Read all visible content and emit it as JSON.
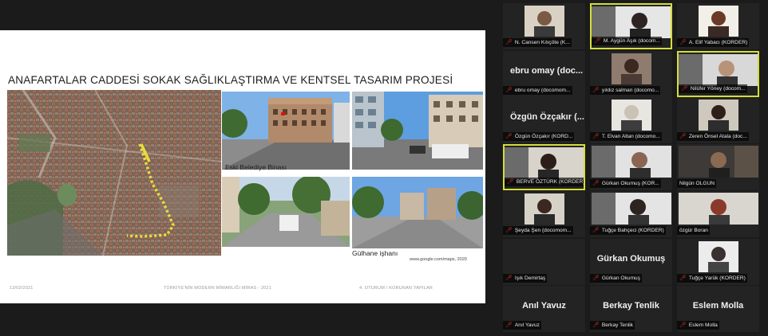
{
  "slide": {
    "title": "ANAFARTALAR CADDESİ SOKAK SAĞLIKLAŞTIRMA VE KENTSEL TASARIM PROJESİ",
    "captions": {
      "photo1": "Eski Belediye Binası",
      "photo2": "Gülhane işhanı",
      "source": "www.google.com/maps, 2020"
    },
    "footer": {
      "date": "13/02/2021",
      "course": "TÜRKİYE'NİN MODERN MİMARLIĞI MİRAS - 2021",
      "section": "4. OTURUM / KORUNAN YAPILAR"
    }
  },
  "participants": [
    {
      "name": "N. Cansen Kılıçöte (K...",
      "big": "",
      "active": false
    },
    {
      "name": "M. Aygün Aşık (docom...",
      "big": "",
      "active": true
    },
    {
      "name": "A. Elif Yabacı (KORDER)",
      "big": "",
      "active": false
    },
    {
      "name": "ebru omay (docomom...",
      "big": "ebru omay (doc...",
      "active": false
    },
    {
      "name": "yıldız salman (docomo...",
      "big": "",
      "active": false
    },
    {
      "name": "Nilüfer Yöney (docom...",
      "big": "",
      "active": true
    },
    {
      "name": "Özgün Özçakır (KORD...",
      "big": "Özgün Özçakır (...",
      "active": false
    },
    {
      "name": "T. Elvan Altan (docomo...",
      "big": "",
      "active": false
    },
    {
      "name": "Zeren Önsel Atala (doc...",
      "big": "",
      "active": false
    },
    {
      "name": "BERVE ÖZTÜRK (KORDER)",
      "big": "",
      "active": true
    },
    {
      "name": "Gürkan Okumuş (KOR...",
      "big": "",
      "active": false
    },
    {
      "name": "Nilgün OLGUN",
      "big": "",
      "active": false
    },
    {
      "name": "Şeyda Şen (docomom...",
      "big": "",
      "active": false
    },
    {
      "name": "Tuğçe Bahçeci (KORDER)",
      "big": "",
      "active": false
    },
    {
      "name": "özgür Boran",
      "big": "",
      "active": false
    },
    {
      "name": "Işık Demirtaş",
      "big": "",
      "active": false
    },
    {
      "name": "Gürkan Okumuş",
      "big": "Gürkan Okumuş",
      "active": false
    },
    {
      "name": "Tuğçe Yarük (KORDER)",
      "big": "",
      "active": false
    },
    {
      "name": "Anıl Yavuz",
      "big": "Anıl Yavuz",
      "active": false
    },
    {
      "name": "Berkay Tenlik",
      "big": "Berkay Tenlik",
      "active": false
    },
    {
      "name": "Eslem Molla",
      "big": "Eslem Molla",
      "active": false
    }
  ],
  "colors": {
    "background": "#1b1b1b",
    "tile": "#232323",
    "active_border": "#d6dd3a",
    "muted_mic": "#e0312f",
    "route": "#e9dc3e"
  }
}
